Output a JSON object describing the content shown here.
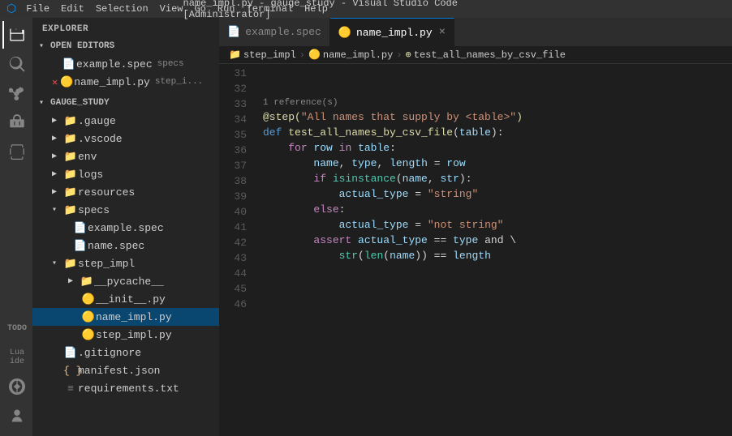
{
  "titlebar": {
    "menu_items": [
      "File",
      "Edit",
      "Selection",
      "View",
      "Go",
      "Run",
      "Terminal",
      "Help"
    ],
    "title": "name_impl.py - gauge_study - Visual Studio Code [Administrator]"
  },
  "sidebar": {
    "title": "EXPLORER",
    "open_editors_label": "OPEN EDITORS",
    "open_editors": [
      {
        "name": "example.spec",
        "badge": "specs",
        "icon": "📄",
        "modified": false
      },
      {
        "name": "name_impl.py",
        "badge": "step_i...",
        "icon": "🟡",
        "modified": true,
        "active": true
      }
    ],
    "project_label": "GAUGE_STUDY",
    "tree": [
      {
        "label": ".gauge",
        "type": "folder",
        "depth": 1,
        "collapsed": true
      },
      {
        "label": ".vscode",
        "type": "folder",
        "depth": 1,
        "collapsed": true
      },
      {
        "label": "env",
        "type": "folder",
        "depth": 1,
        "collapsed": true
      },
      {
        "label": "logs",
        "type": "folder",
        "depth": 1,
        "collapsed": true
      },
      {
        "label": "resources",
        "type": "folder",
        "depth": 1,
        "collapsed": true
      },
      {
        "label": "specs",
        "type": "folder",
        "depth": 1,
        "collapsed": false,
        "color": "red"
      },
      {
        "label": "example.spec",
        "type": "file",
        "depth": 2,
        "icon": "spec"
      },
      {
        "label": "name.spec",
        "type": "file",
        "depth": 2,
        "icon": "spec"
      },
      {
        "label": "step_impl",
        "type": "folder",
        "depth": 1,
        "collapsed": false
      },
      {
        "label": "__pycache__",
        "type": "folder",
        "depth": 2,
        "collapsed": true
      },
      {
        "label": "__init__.py",
        "type": "file",
        "depth": 2,
        "icon": "py"
      },
      {
        "label": "name_impl.py",
        "type": "file",
        "depth": 2,
        "icon": "py-active",
        "active": true
      },
      {
        "label": "step_impl.py",
        "type": "file",
        "depth": 2,
        "icon": "py"
      },
      {
        "label": ".gitignore",
        "type": "file",
        "depth": 1,
        "icon": "gitignore"
      },
      {
        "label": "manifest.json",
        "type": "file",
        "depth": 1,
        "icon": "json"
      },
      {
        "label": "requirements.txt",
        "type": "file",
        "depth": 1,
        "icon": "txt"
      }
    ]
  },
  "tabs": [
    {
      "label": "example.spec",
      "icon": "spec",
      "active": false
    },
    {
      "label": "name_impl.py",
      "icon": "py",
      "active": true
    }
  ],
  "breadcrumb": {
    "parts": [
      "step_impl",
      "name_impl.py",
      "test_all_names_by_csv_file"
    ]
  },
  "code": {
    "reference_line_num": "33",
    "reference_text": "1 reference(s)",
    "lines": [
      {
        "num": 31,
        "content": ""
      },
      {
        "num": 32,
        "content": ""
      },
      {
        "num": 33,
        "content": "@step(\"All names that supply by <table>\")",
        "type": "decorator"
      },
      {
        "num": 34,
        "content": "def test_all_names_by_csv_file(table):",
        "type": "def"
      },
      {
        "num": 35,
        "content": "    for row in table:",
        "type": "for"
      },
      {
        "num": 36,
        "content": "        name, type, length = row",
        "type": "assign"
      },
      {
        "num": 37,
        "content": "        if isinstance(name, str):",
        "type": "if"
      },
      {
        "num": 38,
        "content": "            actual_type = \"string\"",
        "type": "assign-str"
      },
      {
        "num": 39,
        "content": "        else:",
        "type": "else"
      },
      {
        "num": 40,
        "content": "            actual_type = \"not string\"",
        "type": "assign-str"
      },
      {
        "num": 41,
        "content": "        assert actual_type == type and \\",
        "type": "assert"
      },
      {
        "num": 42,
        "content": "            str(len(name)) == length",
        "type": "assert-cont"
      },
      {
        "num": 43,
        "content": ""
      },
      {
        "num": 44,
        "content": ""
      },
      {
        "num": 45,
        "content": ""
      },
      {
        "num": 46,
        "content": ""
      }
    ]
  }
}
